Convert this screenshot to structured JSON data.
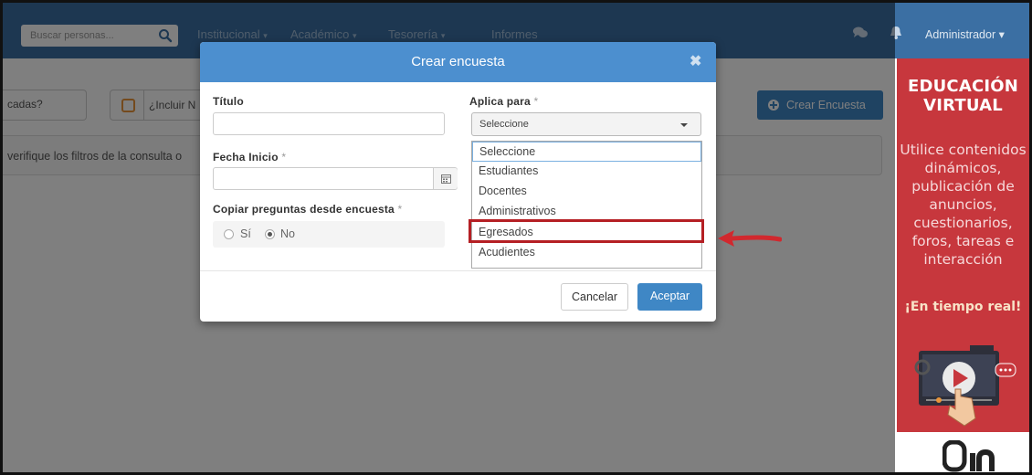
{
  "navbar": {
    "search_placeholder": "Buscar personas...",
    "menu": [
      {
        "label": "Institucional",
        "caret": "▾"
      },
      {
        "label": "Académico",
        "caret": "▾"
      },
      {
        "label": "Tesorería",
        "caret": "▾"
      },
      {
        "label": "Informes"
      }
    ],
    "user": "Administrador ▾"
  },
  "page": {
    "field_fragment": "cadas?",
    "include_label": "¿Incluir N",
    "create_button": "Crear Encuesta",
    "alert_text": "verifique los filtros de la consulta o"
  },
  "modal": {
    "title": "Crear encuesta",
    "close": "✖",
    "titulo_label": "Título",
    "fecha_label": "Fecha Inicio",
    "copiar_label": "Copiar preguntas desde encuesta",
    "required_mark": "*",
    "radio_si": "Sí",
    "radio_no": "No",
    "radio_selected": "No",
    "aplica_label": "Aplica para",
    "select_value": "Seleccione",
    "options": [
      "Seleccione",
      "Estudiantes",
      "Docentes",
      "Administrativos",
      "Egresados",
      "Acudientes"
    ],
    "highlighted_option": "Egresados",
    "cancel": "Cancelar",
    "accept": "Aceptar"
  },
  "promo": {
    "title": "EDUCACIÓN VIRTUAL",
    "body": "Utilice contenidos dinámicos, publicación de anuncios, cuestionarios, foros, tareas e interacción",
    "tagline": "¡En tiempo real!"
  },
  "colors": {
    "navbar": "#3b6fa3",
    "modal_header": "#4c8fcf",
    "primary_button": "#3f87c5",
    "promo": "#c7373d",
    "highlight": "#b51f24"
  },
  "icons": [
    "search-icon",
    "chat-icon",
    "bell-icon",
    "calendar-icon",
    "plus-circle-icon",
    "close-icon",
    "caret-down-icon",
    "red-arrow-icon"
  ]
}
